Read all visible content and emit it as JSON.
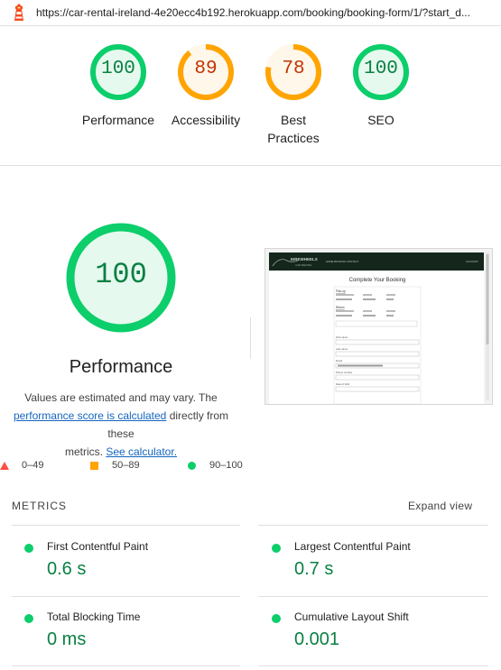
{
  "topbar": {
    "url": "https://car-rental-ireland-4e20ecc4b192.herokuapp.com/booking/booking-form/1/?start_d..."
  },
  "gauges": [
    {
      "score": "100",
      "label": "Performance",
      "level": 1.0,
      "color": "#0cce6b",
      "bg": "#e6f9ee",
      "text": "#0a8043"
    },
    {
      "score": "89",
      "label": "Accessibility",
      "level": 0.89,
      "color": "#ffa400",
      "bg": "#fff7ea",
      "text": "#c33300"
    },
    {
      "score": "78",
      "label": "Best Practices",
      "level": 0.78,
      "color": "#ffa400",
      "bg": "#fff7ea",
      "text": "#c33300"
    },
    {
      "score": "100",
      "label": "SEO",
      "level": 1.0,
      "color": "#0cce6b",
      "bg": "#e6f9ee",
      "text": "#0a8043"
    }
  ],
  "performance": {
    "score": "100",
    "title": "Performance",
    "desc_1": "Values are estimated and may vary. The",
    "link_1": "performance score is calculated",
    "desc_2": " directly from these",
    "desc_3": "metrics.",
    "link_2": "See calculator."
  },
  "legend": {
    "fail": "0–49",
    "average": "50–89",
    "pass": "90–100"
  },
  "screenshot": {
    "brand": "EIREWHEELS",
    "brand_sub": "CAR RENTAL",
    "nav": "HOME  BOOKING  CONTACT",
    "account": "ACCOUNT",
    "heading": "Complete Your Booking",
    "pickup": "Pick-up",
    "return": "Return",
    "first_name": "First name",
    "last_name": "Last name",
    "email": "Email",
    "phone": "Phone number",
    "date_of_birth": "Date of birth"
  },
  "metrics": {
    "heading": "METRICS",
    "expand": "Expand view",
    "items": [
      {
        "name": "First Contentful Paint",
        "value": "0.6 s"
      },
      {
        "name": "Largest Contentful Paint",
        "value": "0.7 s"
      },
      {
        "name": "Total Blocking Time",
        "value": "0 ms"
      },
      {
        "name": "Cumulative Layout Shift",
        "value": "0.001"
      }
    ]
  },
  "colors": {
    "pass": "#0cce6b",
    "average": "#ffa400",
    "fail": "#ff4e42",
    "link": "#1565c0"
  }
}
